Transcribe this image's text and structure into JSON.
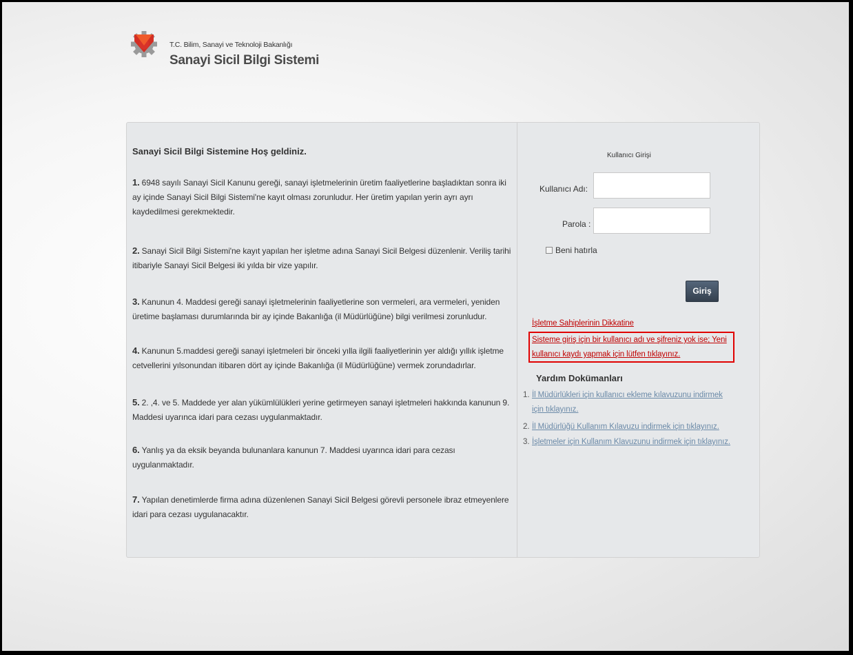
{
  "header": {
    "ministry": "T.C. Bilim, Sanayi ve Teknoloji Bakanlığı",
    "system_name": "Sanayi Sicil Bilgi Sistemi",
    "logo_icon": "gear-logo-icon"
  },
  "info": {
    "welcome": "Sanayi Sicil Bilgi Sistemine Hoş geldiniz.",
    "items": [
      {
        "num": "1.",
        "text": "6948 sayılı Sanayi Sicil Kanunu gereği, sanayi işletmelerinin üretim faaliyetlerine başladıktan sonra iki ay içinde Sanayi Sicil Bilgi Sistemi'ne kayıt olması zorunludur. Her üretim yapılan yerin ayrı ayrı kaydedilmesi gerekmektedir."
      },
      {
        "num": "2.",
        "text": "Sanayi Sicil Bilgi Sistemi'ne kayıt yapılan her işletme adına Sanayi Sicil Belgesi düzenlenir. Veriliş tarihi itibariyle Sanayi Sicil Belgesi iki yılda bir vize yapılır."
      },
      {
        "num": "3.",
        "text": "Kanunun 4. Maddesi gereği sanayi işletmelerinin faaliyetlerine son vermeleri, ara vermeleri, yeniden üretime başlaması durumlarında bir ay içinde Bakanlığa (il Müdürlüğüne) bilgi verilmesi zorunludur."
      },
      {
        "num": "4.",
        "text": "Kanunun 5.maddesi gereği sanayi işletmeleri bir önceki yılla ilgili faaliyetlerinin yer aldığı yıllık işletme cetvellerini yılsonundan itibaren dört ay içinde Bakanlığa (il Müdürlüğüne) vermek zorundadırlar."
      },
      {
        "num": "5.",
        "text": "2. ,4. ve 5. Maddede yer alan yükümlülükleri yerine getirmeyen sanayi işletmeleri hakkında kanunun 9. Maddesi uyarınca idari para cezası uygulanmaktadır."
      },
      {
        "num": "6.",
        "text": "Yanlış ya da eksik beyanda bulunanlara kanunun 7. Maddesi uyarınca idari para cezası uygulanmaktadır."
      },
      {
        "num": "7.",
        "text": "Yapılan denetimlerde firma adına düzenlenen Sanayi Sicil Belgesi görevli personele ibraz etmeyenlere idari para cezası uygulanacaktır."
      }
    ]
  },
  "login": {
    "title": "Kullanıcı Girişi",
    "username_label": "Kullanıcı Adı:",
    "username_value": "",
    "password_label": "Parola :",
    "password_value": "",
    "remember_label": "Beni hatırla",
    "remember_checked": false,
    "submit_label": "Giriş"
  },
  "notices": {
    "owners_link": "İşletme Sahiplerinin Dikkatine",
    "register_line1": "Sisteme giriş için bir kullanıcı adı ve şifreniz yok ise; Yeni",
    "register_line2": "kullanıcı kaydı yapmak için lütfen tıklayınız.",
    "highlight_color": "#e00000"
  },
  "help": {
    "title": "Yardım Dokümanları",
    "items": [
      {
        "num": "1.",
        "line1": "İl Müdürlükleri için kullanıcı ekleme kılavuzunu indirmek",
        "line2": "için tıklayınız."
      },
      {
        "num": "2.",
        "line1": "İl Müdürlüğü Kullanım Kılavuzu indirmek için tıklayınız."
      },
      {
        "num": "3.",
        "line1": "İşletmeler için Kullanım Klavuzunu indirmek için tıklayınız."
      }
    ]
  },
  "colors": {
    "link_red": "#c00000",
    "link_blue": "#6b8aa8",
    "button_bg": "#3f4b5a",
    "panel_bg": "#e6e8ea"
  }
}
